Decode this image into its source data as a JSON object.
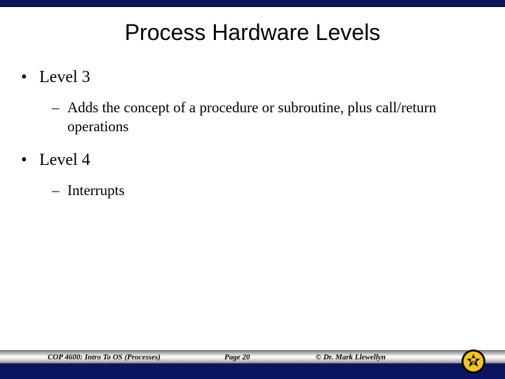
{
  "title": "Process Hardware Levels",
  "bullets": {
    "level3": {
      "label": "Level 3",
      "sub": "Adds the concept of a procedure or subroutine, plus call/return operations"
    },
    "level4": {
      "label": "Level 4",
      "sub": "Interrupts"
    }
  },
  "footer": {
    "left": "COP 4600: Intro To OS  (Processes)",
    "center": "Page 20",
    "right": "© Dr. Mark Llewellyn"
  }
}
